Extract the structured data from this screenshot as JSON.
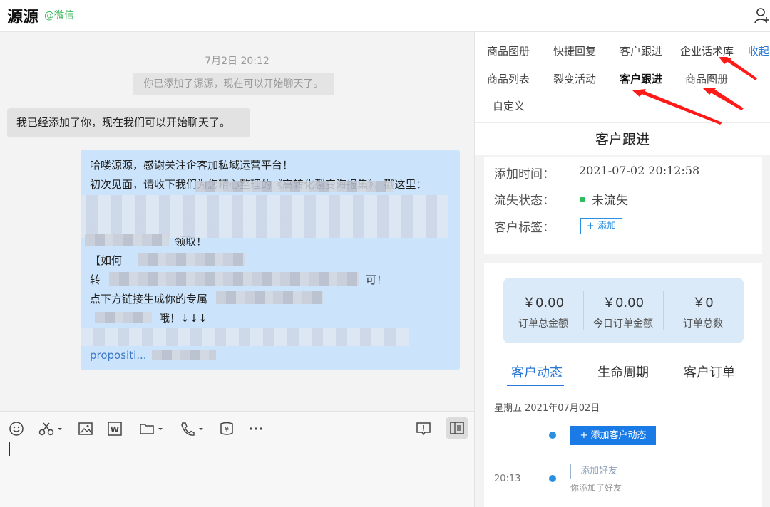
{
  "header": {
    "name": "源源",
    "source": "@微信",
    "add_icon": "add-contact-icon"
  },
  "chat": {
    "timestamp": "7月2日 20:12",
    "system_notice": "你已添加了源源，现在可以开始聊天了。",
    "incoming_message": "我已经添加了你，现在我们可以开始聊天了。",
    "outgoing_lines": [
      "哈喽源源，感谢关注企客加私域运营平台！",
      "初次见面，请收下我们为您精心整理的《高转化裂变海报集》，戳这里：",
      "领取！",
      "【如何",
      "转",
      "可！",
      "点下方链接生成你的专属",
      "哦！↓↓↓",
      "propositi..."
    ]
  },
  "toolbar": {
    "icons": [
      "emoji-icon",
      "scissors-icon",
      "image-icon",
      "word-doc-icon",
      "folder-icon",
      "phone-icon",
      "red-packet-icon",
      "more-icon",
      "chat-history-icon",
      "side-panel-icon"
    ]
  },
  "panel": {
    "tabs_row1": [
      "商品图册",
      "快捷回复",
      "客户跟进",
      "企业话术库"
    ],
    "collapse": "收起",
    "tabs_row2": [
      "商品列表",
      "裂变活动",
      "客户跟进",
      "商品图册"
    ],
    "tabs_row3": [
      "自定义"
    ],
    "title": "客户跟进",
    "info": {
      "added_time_label": "添加时间：",
      "added_time_value": "2021-07-02 20:12:58",
      "status_label": "流失状态：",
      "status_value": "未流失",
      "tags_label": "客户标签：",
      "tag_add": "+ 添加"
    },
    "stats": [
      {
        "value": "￥0.00",
        "label": "订单总金额"
      },
      {
        "value": "￥0.00",
        "label": "今日订单金额"
      },
      {
        "value": "￥0",
        "label": "订单总数"
      }
    ],
    "subtabs": [
      "客户动态",
      "生命周期",
      "客户订单"
    ],
    "timeline": {
      "date": "星期五 2021年07月02日",
      "add_button": "+ 添加客户动态",
      "time": "20:13",
      "badge": "添加好友",
      "note": "你添加了好友"
    }
  },
  "colors": {
    "accent": "#1a7be6",
    "bubble_out": "#cbe4fb",
    "bubble_in": "#e2e2e2",
    "source_green": "#3ab55a",
    "annotation": "#ff1a1a"
  }
}
